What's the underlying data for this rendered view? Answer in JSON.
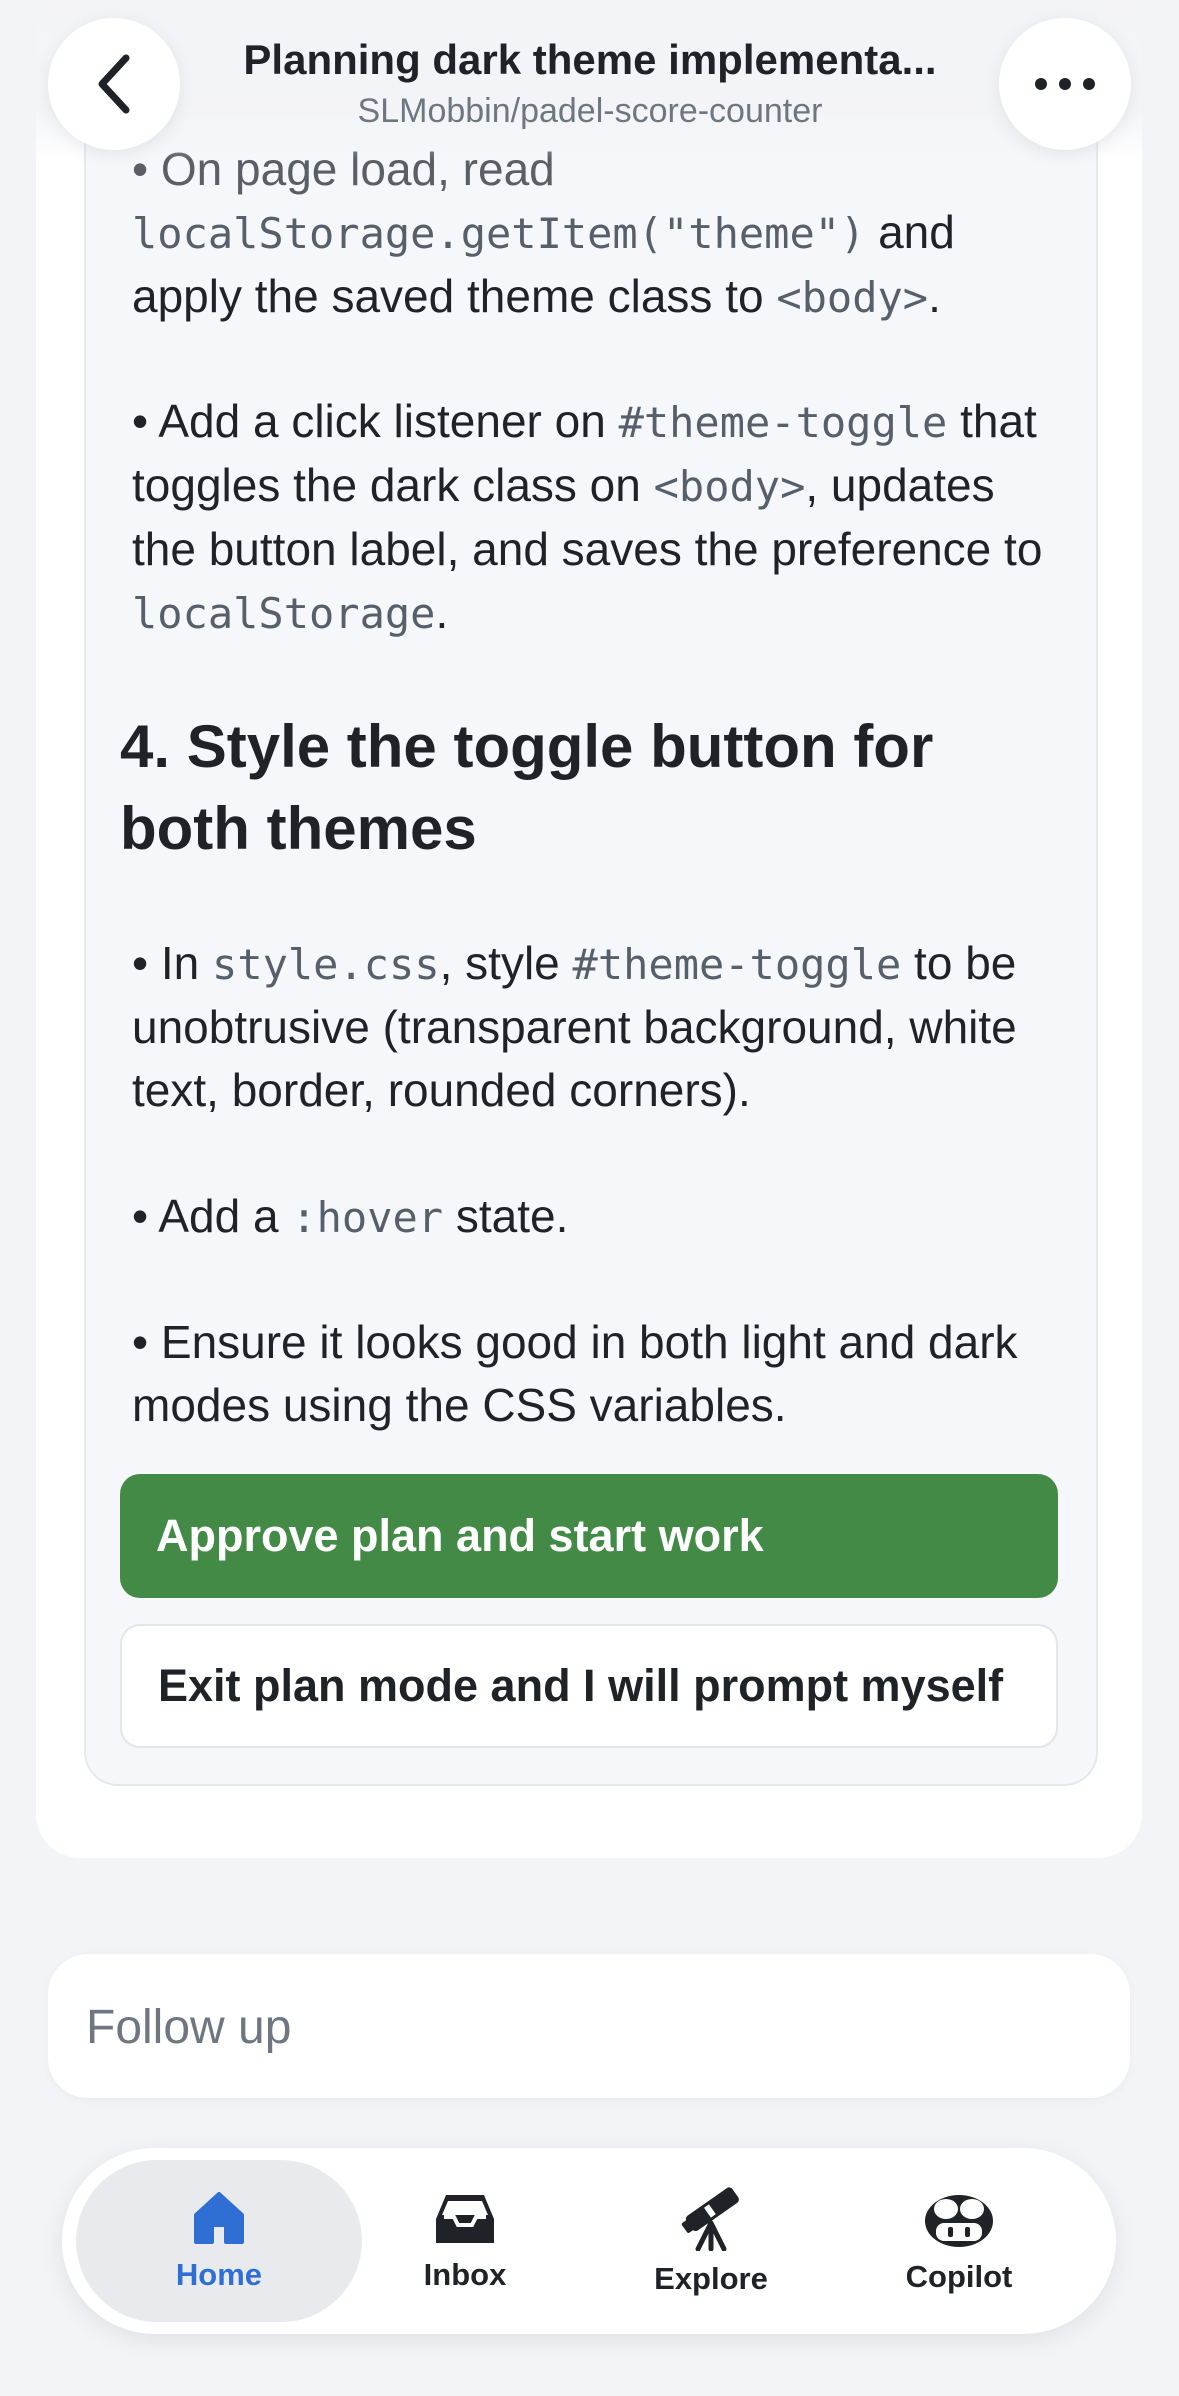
{
  "header": {
    "title": "Planning dark theme implementa...",
    "subtitle": "SLMobbin/padel-score-counter"
  },
  "content": {
    "p1": {
      "b": "• On page load, read",
      "code1": "localStorage.getItem(\"theme\")",
      "t1": " and apply the saved theme class to ",
      "code2": "<body>",
      "t2": "."
    },
    "p2": {
      "b": "• Add a click listener on ",
      "code1": "#theme-toggle",
      "t1": " that toggles the dark class on ",
      "code2": "<body>",
      "t2": ", updates the button label, and saves the preference to ",
      "code3": "localStorage",
      "t3": "."
    },
    "heading": "4. Style the toggle button for both themes",
    "p3": {
      "b": "• In ",
      "code1": "style.css",
      "t1": ", style ",
      "code2": "#theme-toggle",
      "t2": " to be unobtrusive (transparent background, white text, border, rounded corners)."
    },
    "p4": {
      "b": "• Add a ",
      "code1": ":hover",
      "t1": " state."
    },
    "p5": {
      "b": "• Ensure it looks good in both light and dark modes using the CSS variables."
    }
  },
  "actions": {
    "approve": "Approve plan and start work",
    "exit": "Exit plan mode and I will prompt myself"
  },
  "follow_up": {
    "placeholder": "Follow up"
  },
  "tabs": [
    {
      "label": "Home",
      "icon": "home-icon",
      "active": true
    },
    {
      "label": "Inbox",
      "icon": "inbox-icon",
      "active": false
    },
    {
      "label": "Explore",
      "icon": "telescope-icon",
      "active": false
    },
    {
      "label": "Copilot",
      "icon": "copilot-icon",
      "active": false
    }
  ],
  "colors": {
    "approve": "#438a47",
    "active_tab": "#2f6fd3"
  }
}
